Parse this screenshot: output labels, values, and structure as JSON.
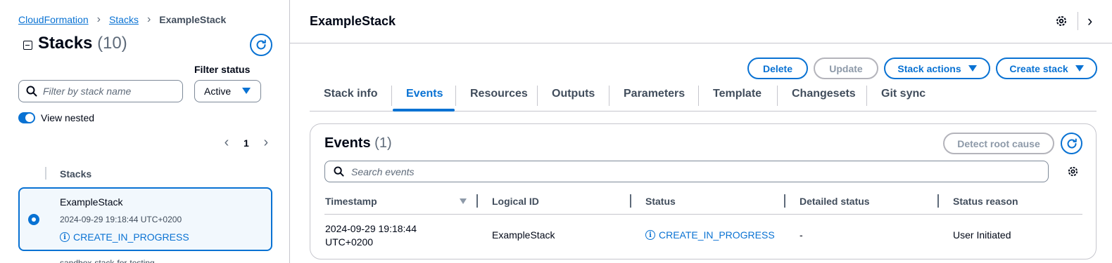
{
  "breadcrumb": {
    "items": [
      "CloudFormation",
      "Stacks"
    ],
    "current": "ExampleStack"
  },
  "sidebar": {
    "title": "Stacks",
    "count": "(10)",
    "filter_label": "Filter status",
    "search_placeholder": "Filter by stack name",
    "filter_value": "Active",
    "view_nested_label": "View nested",
    "view_nested_on": true,
    "page": "1",
    "column_header": "Stacks",
    "selected_stack": {
      "name": "ExampleStack",
      "timestamp": "2024-09-29 19:18:44 UTC+0200",
      "status": "CREATE_IN_PROGRESS"
    },
    "next_row_peek": "sandbox-stack-for-testing"
  },
  "main": {
    "title": "ExampleStack",
    "actions": {
      "delete": "Delete",
      "update": "Update",
      "stack_actions": "Stack actions",
      "create_stack": "Create stack"
    },
    "tabs": [
      "Stack info",
      "Events",
      "Resources",
      "Outputs",
      "Parameters",
      "Template",
      "Changesets",
      "Git sync"
    ],
    "active_tab": "Events",
    "events": {
      "title": "Events",
      "count": "(1)",
      "detect_label": "Detect root cause",
      "search_placeholder": "Search events",
      "columns": [
        "Timestamp",
        "Logical ID",
        "Status",
        "Detailed status",
        "Status reason"
      ],
      "rows": [
        {
          "timestamp_line1": "2024-09-29 19:18:44",
          "timestamp_line2": "UTC+0200",
          "logical_id": "ExampleStack",
          "status": "CREATE_IN_PROGRESS",
          "detailed_status": "-",
          "status_reason": "User Initiated"
        }
      ]
    }
  },
  "colors": {
    "accent": "#0972d3",
    "text": "#000716",
    "muted": "#5f6b7a",
    "selected_bg": "#f2f8fd",
    "border": "#c6c6cd"
  },
  "icons": [
    "refresh-icon",
    "search-icon",
    "chevron-left-icon",
    "chevron-right-icon",
    "info-icon",
    "settings-icon",
    "caret-down-icon"
  ]
}
